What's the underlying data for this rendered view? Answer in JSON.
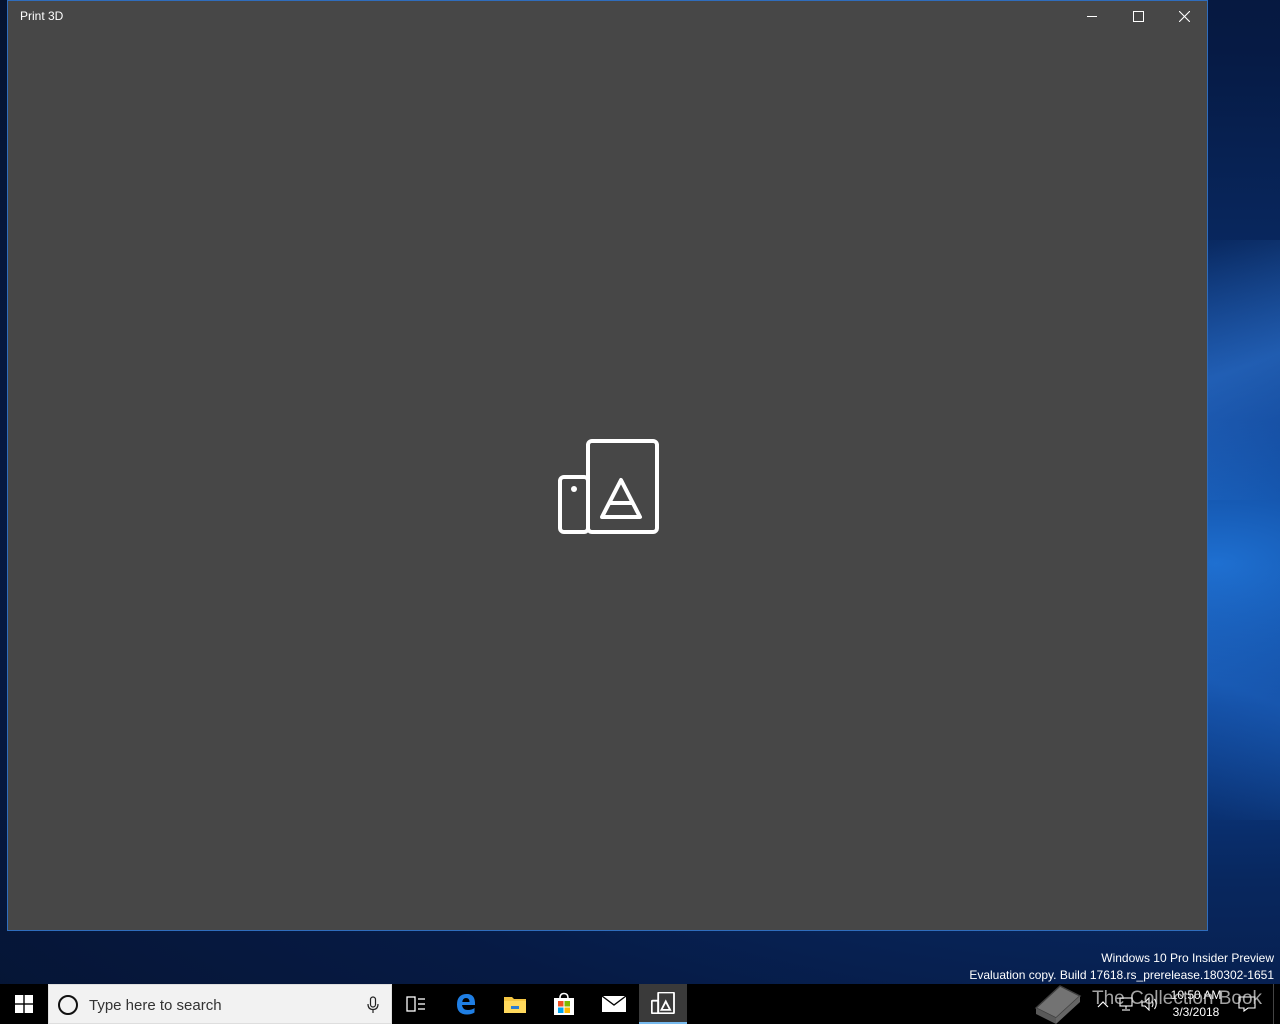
{
  "window": {
    "title": "Print 3D",
    "controls": {
      "minimize": "minimize-icon",
      "maximize": "maximize-icon",
      "close": "close-icon"
    },
    "background": "#474747",
    "border_color": "#2f6dbd",
    "splash_icon": "print-3d-app-icon"
  },
  "desktop": {
    "watermark_line1": "Windows 10 Pro Insider Preview",
    "watermark_line2": "Evaluation copy. Build 17618.rs_prerelease.180302-1651"
  },
  "taskbar": {
    "search_placeholder": "Type here to search",
    "pinned": [
      "task-view-icon",
      "edge-icon",
      "file-explorer-icon",
      "store-icon",
      "mail-icon",
      "print-3d-icon"
    ],
    "active": "print-3d-icon",
    "accent": "#76b9ed",
    "tray_icons": [
      "chevron-up-icon",
      "network-icon",
      "volume-icon",
      "action-center-icon"
    ],
    "time": "10:50 AM",
    "date": "3/3/2018",
    "overlay_text": "The Collection Book"
  }
}
